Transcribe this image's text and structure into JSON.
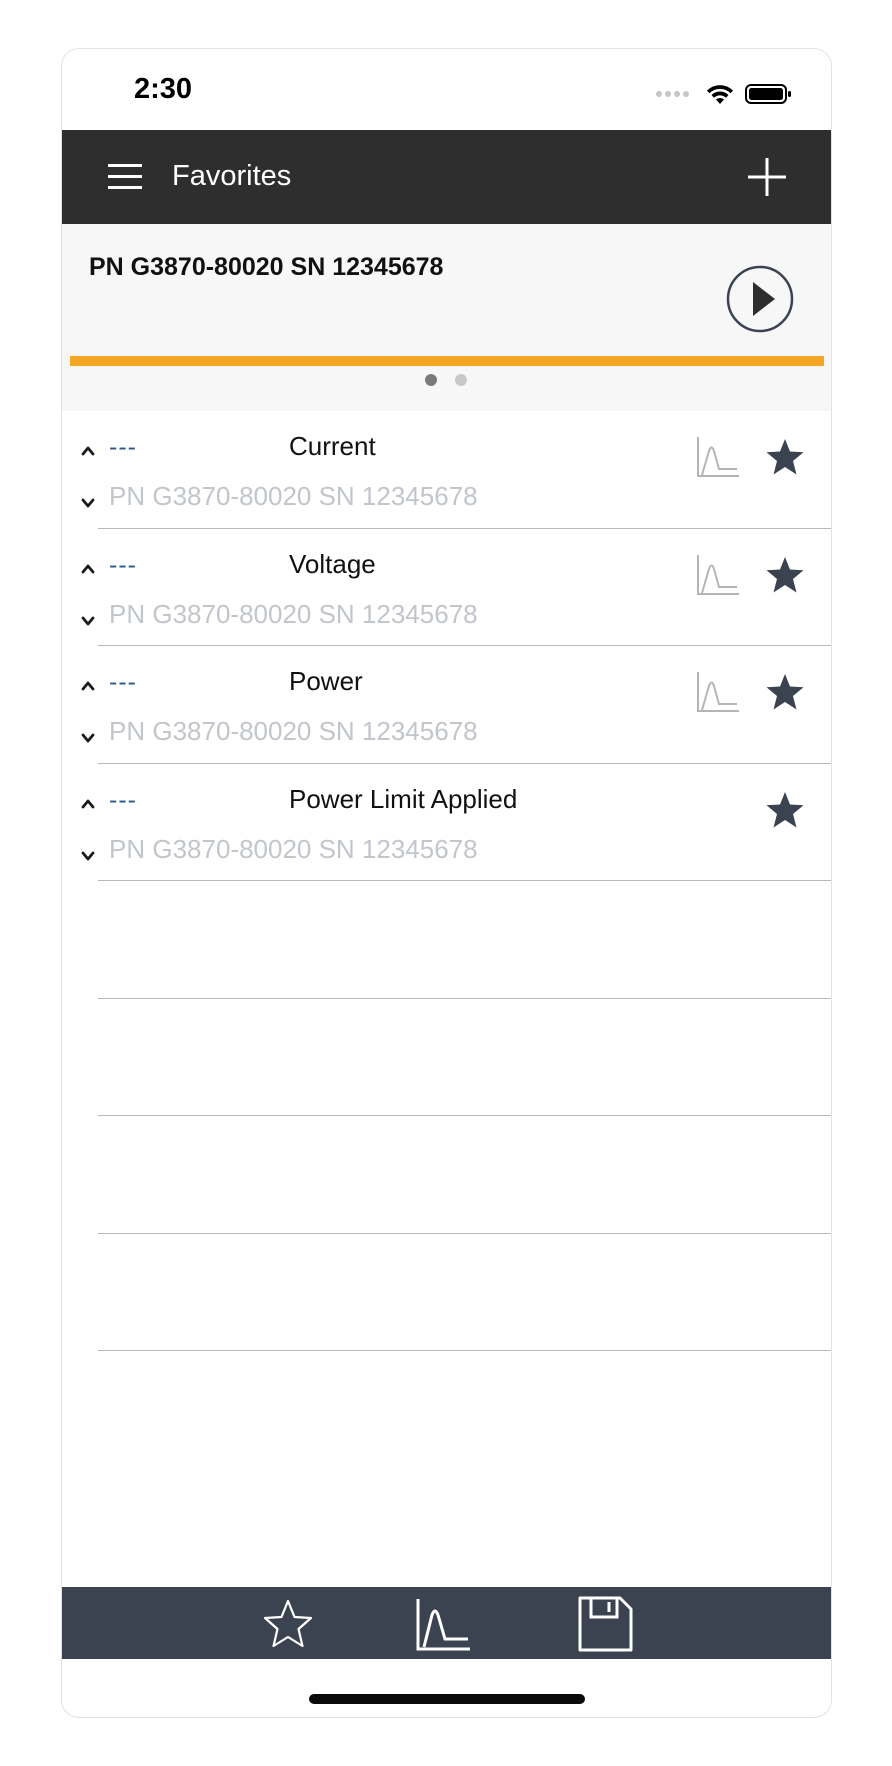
{
  "status_bar": {
    "time": "2:30"
  },
  "nav": {
    "title": "Favorites"
  },
  "device": {
    "title": "PN G3870-80020 SN 12345678",
    "progress_fraction": 1.0,
    "page_count": 2,
    "active_page": 1
  },
  "rows": [
    {
      "value": "---",
      "name": "Current",
      "device": "PN G3870-80020 SN 12345678",
      "has_chart": true,
      "favorited": true
    },
    {
      "value": "---",
      "name": "Voltage",
      "device": "PN G3870-80020 SN 12345678",
      "has_chart": true,
      "favorited": true
    },
    {
      "value": "---",
      "name": "Power",
      "device": "PN G3870-80020 SN 12345678",
      "has_chart": true,
      "favorited": true
    },
    {
      "value": "---",
      "name": "Power Limit Applied",
      "device": "PN G3870-80020 SN 12345678",
      "has_chart": false,
      "favorited": true
    }
  ],
  "empty_row_count": 4,
  "tab_bar": {
    "items": [
      {
        "icon": "star-outline-icon"
      },
      {
        "icon": "chart-icon"
      },
      {
        "icon": "save-icon"
      }
    ]
  },
  "colors": {
    "nav_bg": "#2e2e2e",
    "tab_bar_bg": "#3b4350",
    "accent_progress": "#f5a623",
    "value_text": "#2e5a8a",
    "subtext": "#c2c6cb",
    "star_fill": "#3b4350"
  }
}
